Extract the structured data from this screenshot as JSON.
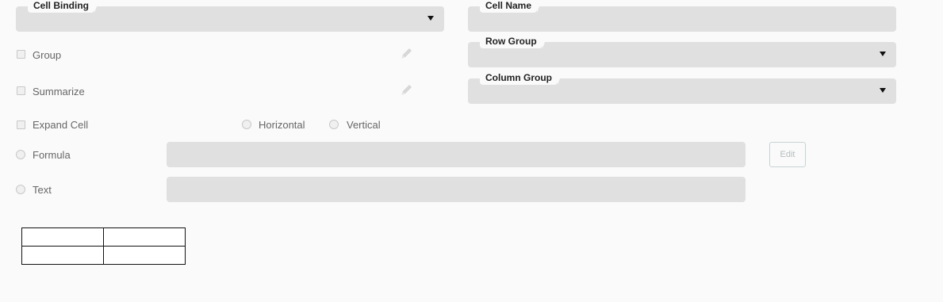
{
  "binding": {
    "cell_binding_label": "Cell Binding",
    "cell_binding_value": "",
    "cell_name_label": "Cell Name",
    "cell_name_value": "",
    "row_group_label": "Row Group",
    "row_group_value": "",
    "column_group_label": "Column Group",
    "column_group_value": ""
  },
  "options": {
    "group_label": "Group",
    "summarize_label": "Summarize",
    "expand_cell_label": "Expand Cell",
    "horizontal_label": "Horizontal",
    "vertical_label": "Vertical",
    "formula_label": "Formula",
    "formula_value": "",
    "text_label": "Text",
    "text_value": "",
    "edit_button_label": "Edit"
  },
  "preview_table": {
    "rows": [
      [
        "",
        ""
      ],
      [
        "",
        ""
      ]
    ]
  },
  "icons": {
    "dropdown": "chevron-down-icon",
    "edit": "pencil-icon"
  },
  "colors": {
    "field_background": "#e0e0e0",
    "page_background": "#fafafa",
    "label_text": "#222222",
    "muted_text": "#666666"
  }
}
